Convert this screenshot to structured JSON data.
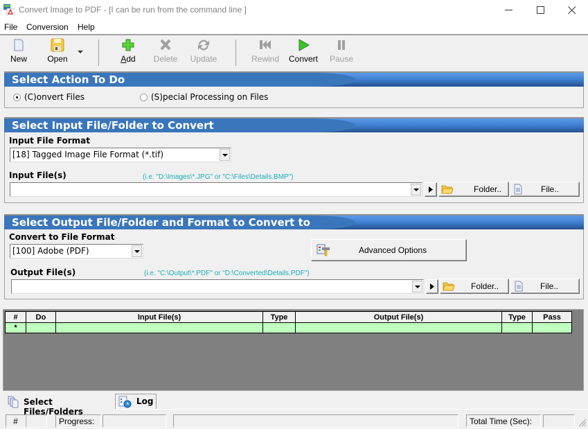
{
  "window": {
    "title": "Convert Image to PDF - [I can be run from the command line ]",
    "minimize": "—",
    "maximize": "☐",
    "close": "✕"
  },
  "menu": [
    "File",
    "Conversion",
    "Help"
  ],
  "toolbar": {
    "new": "New",
    "open": "Open",
    "add": "Add",
    "delete": "Delete",
    "update": "Update",
    "rewind": "Rewind",
    "convert": "Convert",
    "pause": "Pause"
  },
  "action_section": {
    "title": "Select Action To Do",
    "options": [
      {
        "label": "(C)onvert Files",
        "checked": true
      },
      {
        "label": "(S)pecial Processing on Files",
        "checked": false
      }
    ]
  },
  "input_section": {
    "title": "Select Input File/Folder to Convert",
    "format_label": "Input File Format",
    "format_value": "[18] Tagged Image File Format (*.tif)",
    "files_label": "Input File(s)",
    "files_hint": "(i.e. \"D:\\Images\\*.JPG\"  or \"C:\\Files\\Details.BMP\")",
    "files_value": "",
    "folder_button": "Folder..",
    "file_button": "File.."
  },
  "output_section": {
    "title": "Select Output File/Folder and Format to Convert to",
    "format_label": "Convert to File Format",
    "format_value": "[100] Adobe (PDF)",
    "advanced_button": "Advanced Options",
    "files_label": "Output File(s)",
    "files_hint": "(i.e. \"C:\\Output\\*.PDF\" or \"D:\\Converted\\Details.PDF\")",
    "files_value": "",
    "folder_button": "Folder..",
    "file_button": "File.."
  },
  "grid": {
    "columns": [
      "#",
      "Do",
      "Input File(s)",
      "Type",
      "Output File(s)",
      "Type",
      "Pass"
    ],
    "rows": [
      [
        "*",
        "",
        "",
        "",
        "",
        "",
        ""
      ]
    ]
  },
  "tabs": [
    {
      "label": "Select Files/Folders",
      "active": true
    },
    {
      "label": "Log",
      "active": false
    }
  ],
  "status": {
    "hash": "#",
    "count": "",
    "progress_label": "Progress:",
    "progress_value": "",
    "message": "",
    "total_time_label": "Total Time (Sec):",
    "total_time_value": ""
  },
  "colors": {
    "section_header": "#3a76bc",
    "hint_text": "#1ab0b8",
    "grid_row": "#c0ffc0",
    "grid_background": "#808080"
  }
}
